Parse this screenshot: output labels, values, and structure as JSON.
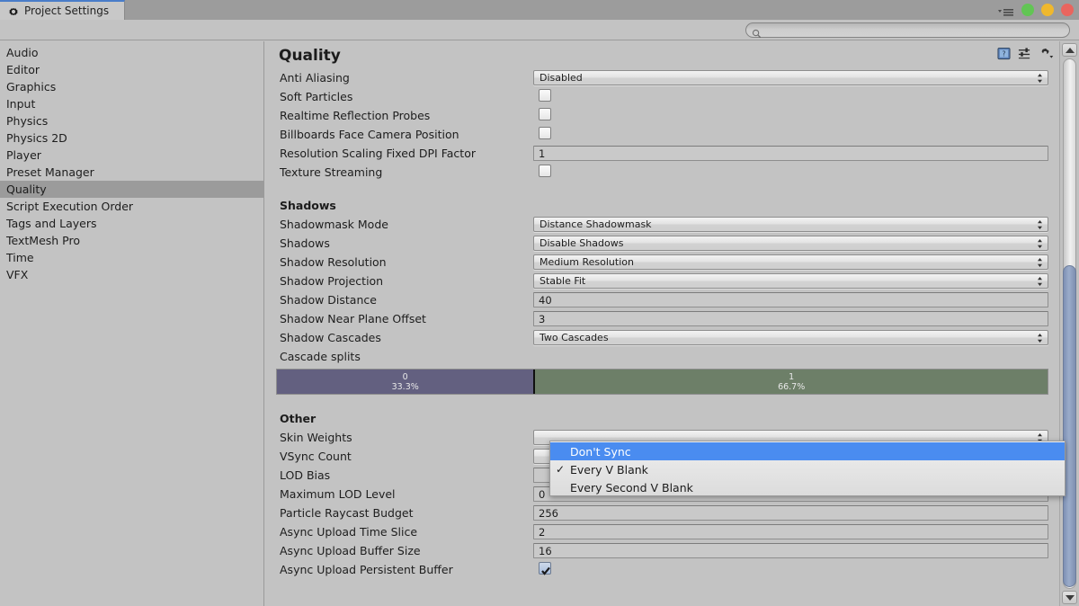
{
  "window": {
    "tab_label": "Project Settings",
    "tab_icon": "gear-icon",
    "menu_icon": "window-menu-icon",
    "buttons": {
      "minimize": "minimize-button",
      "maximize": "maximize-button",
      "close": "close-button"
    }
  },
  "search": {
    "value": "",
    "placeholder": "",
    "icon": "search-icon"
  },
  "sidebar": {
    "items": [
      {
        "label": "Audio",
        "selected": false
      },
      {
        "label": "Editor",
        "selected": false
      },
      {
        "label": "Graphics",
        "selected": false
      },
      {
        "label": "Input",
        "selected": false
      },
      {
        "label": "Physics",
        "selected": false
      },
      {
        "label": "Physics 2D",
        "selected": false
      },
      {
        "label": "Player",
        "selected": false
      },
      {
        "label": "Preset Manager",
        "selected": false
      },
      {
        "label": "Quality",
        "selected": true
      },
      {
        "label": "Script Execution Order",
        "selected": false
      },
      {
        "label": "Tags and Layers",
        "selected": false
      },
      {
        "label": "TextMesh Pro",
        "selected": false
      },
      {
        "label": "Time",
        "selected": false
      },
      {
        "label": "VFX",
        "selected": false
      }
    ]
  },
  "panel": {
    "title": "Quality",
    "icons": [
      {
        "name": "help-icon"
      },
      {
        "name": "preset-icon"
      },
      {
        "name": "settings-gear-icon"
      }
    ],
    "general_rows": [
      {
        "label": "Anti Aliasing",
        "type": "popup",
        "value": "Disabled"
      },
      {
        "label": "Soft Particles",
        "type": "checkbox",
        "checked": false
      },
      {
        "label": "Realtime Reflection Probes",
        "type": "checkbox",
        "checked": false
      },
      {
        "label": "Billboards Face Camera Position",
        "type": "checkbox",
        "checked": false
      },
      {
        "label": "Resolution Scaling Fixed DPI Factor",
        "type": "text",
        "value": "1"
      },
      {
        "label": "Texture Streaming",
        "type": "checkbox",
        "checked": false
      }
    ],
    "shadows_header": "Shadows",
    "shadow_rows": [
      {
        "label": "Shadowmask Mode",
        "type": "popup",
        "value": "Distance Shadowmask"
      },
      {
        "label": "Shadows",
        "type": "popup",
        "value": "Disable Shadows"
      },
      {
        "label": "Shadow Resolution",
        "type": "popup",
        "value": "Medium Resolution"
      },
      {
        "label": "Shadow Projection",
        "type": "popup",
        "value": "Stable Fit"
      },
      {
        "label": "Shadow Distance",
        "type": "text",
        "value": "40"
      },
      {
        "label": "Shadow Near Plane Offset",
        "type": "text",
        "value": "3"
      },
      {
        "label": "Shadow Cascades",
        "type": "popup",
        "value": "Two Cascades"
      },
      {
        "label": "Cascade splits",
        "type": "none",
        "value": ""
      }
    ],
    "cascade_splits": [
      {
        "index": "0",
        "percent": "33.3%",
        "width_pct": 33.3,
        "color": "#636080"
      },
      {
        "index": "1",
        "percent": "66.7%",
        "width_pct": 66.7,
        "color": "#6d7f68"
      }
    ],
    "other_header": "Other",
    "other_rows": [
      {
        "label": "Skin Weights",
        "type": "hidden",
        "value": ""
      },
      {
        "label": "VSync Count",
        "type": "hidden",
        "value": ""
      },
      {
        "label": "LOD Bias",
        "type": "hidden",
        "value": ""
      },
      {
        "label": "Maximum LOD Level",
        "type": "text",
        "value": "0"
      },
      {
        "label": "Particle Raycast Budget",
        "type": "text",
        "value": "256"
      },
      {
        "label": "Async Upload Time Slice",
        "type": "text",
        "value": "2"
      },
      {
        "label": "Async Upload Buffer Size",
        "type": "text",
        "value": "16"
      },
      {
        "label": "Async Upload Persistent Buffer",
        "type": "checkbox",
        "checked": true
      }
    ]
  },
  "dropdown": {
    "open": true,
    "options": [
      {
        "label": "Don't Sync",
        "checked": false,
        "highlighted": true
      },
      {
        "label": "Every V Blank",
        "checked": true,
        "highlighted": false
      },
      {
        "label": "Every Second V Blank",
        "checked": false,
        "highlighted": false
      }
    ]
  },
  "scrollbar": {
    "up_icon": "scroll-up-arrow-icon",
    "down_icon": "scroll-down-arrow-icon"
  },
  "colors": {
    "window_bg": "#c3c3c3",
    "tabbar_bg": "#9c9c9c",
    "selection": "#9b9b9b",
    "highlight_blue": "#4a8cf0",
    "accent_tab_top": "#4a7dc9"
  }
}
